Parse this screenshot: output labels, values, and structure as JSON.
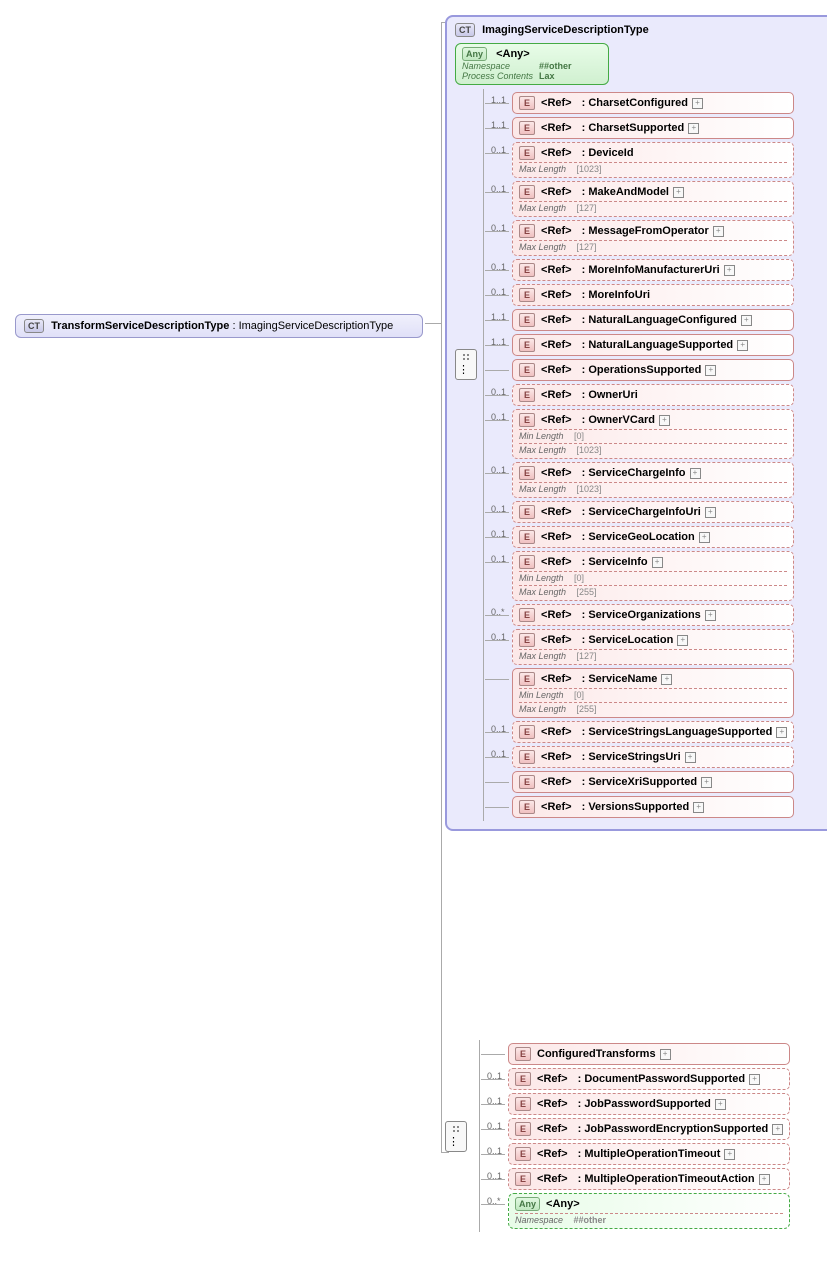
{
  "root": {
    "badge": "CT",
    "name": "TransformServiceDescriptionType",
    "base": "ImagingServiceDescriptionType"
  },
  "parentType": {
    "badge": "CT",
    "name": "ImagingServiceDescriptionType",
    "any": {
      "badge": "Any",
      "label": "<Any>",
      "namespace_k": "Namespace",
      "namespace_v": "##other",
      "pc_k": "Process Contents",
      "pc_v": "Lax"
    },
    "elements": [
      {
        "card": "1..1",
        "ref": "<Ref>",
        "name": ": CharsetConfigured",
        "dashed": false,
        "expand": true
      },
      {
        "card": "1..1",
        "ref": "<Ref>",
        "name": ": CharsetSupported",
        "dashed": false,
        "expand": true
      },
      {
        "card": "0..1",
        "ref": "<Ref>",
        "name": ": DeviceId",
        "dashed": true,
        "constraints": [
          {
            "k": "Max Length",
            "v": "[1023]"
          }
        ]
      },
      {
        "card": "0..1",
        "ref": "<Ref>",
        "name": ": MakeAndModel",
        "dashed": true,
        "expand": true,
        "constraints": [
          {
            "k": "Max Length",
            "v": "[127]"
          }
        ]
      },
      {
        "card": "0..1",
        "ref": "<Ref>",
        "name": ": MessageFromOperator",
        "dashed": true,
        "expand": true,
        "constraints": [
          {
            "k": "Max Length",
            "v": "[127]"
          }
        ]
      },
      {
        "card": "0..1",
        "ref": "<Ref>",
        "name": ": MoreInfoManufacturerUri",
        "dashed": true,
        "expand": true
      },
      {
        "card": "0..1",
        "ref": "<Ref>",
        "name": ": MoreInfoUri",
        "dashed": true
      },
      {
        "card": "1..1",
        "ref": "<Ref>",
        "name": ": NaturalLanguageConfigured",
        "dashed": false,
        "expand": true
      },
      {
        "card": "1..1",
        "ref": "<Ref>",
        "name": ": NaturalLanguageSupported",
        "dashed": false,
        "expand": true
      },
      {
        "card": "",
        "ref": "<Ref>",
        "name": ": OperationsSupported",
        "dashed": false,
        "expand": true,
        "noCard": true
      },
      {
        "card": "0..1",
        "ref": "<Ref>",
        "name": ": OwnerUri",
        "dashed": true
      },
      {
        "card": "0..1",
        "ref": "<Ref>",
        "name": ": OwnerVCard",
        "dashed": true,
        "expand": true,
        "constraints": [
          {
            "k": "Min Length",
            "v": "[0]"
          },
          {
            "k": "Max Length",
            "v": "[1023]"
          }
        ]
      },
      {
        "card": "0..1",
        "ref": "<Ref>",
        "name": ": ServiceChargeInfo",
        "dashed": true,
        "expand": true,
        "constraints": [
          {
            "k": "Max Length",
            "v": "[1023]"
          }
        ]
      },
      {
        "card": "0..1",
        "ref": "<Ref>",
        "name": ": ServiceChargeInfoUri",
        "dashed": true,
        "expand": true
      },
      {
        "card": "0..1",
        "ref": "<Ref>",
        "name": ": ServiceGeoLocation",
        "dashed": true,
        "expand": true
      },
      {
        "card": "0..1",
        "ref": "<Ref>",
        "name": ": ServiceInfo",
        "dashed": true,
        "expand": true,
        "constraints": [
          {
            "k": "Min Length",
            "v": "[0]"
          },
          {
            "k": "Max Length",
            "v": "[255]"
          }
        ]
      },
      {
        "card": "0..*",
        "ref": "<Ref>",
        "name": ": ServiceOrganizations",
        "dashed": true,
        "expand": true
      },
      {
        "card": "0..1",
        "ref": "<Ref>",
        "name": ": ServiceLocation",
        "dashed": true,
        "expand": true,
        "constraints": [
          {
            "k": "Max Length",
            "v": "[127]"
          }
        ]
      },
      {
        "card": "",
        "ref": "<Ref>",
        "name": ": ServiceName",
        "dashed": false,
        "expand": true,
        "noCard": true,
        "constraints": [
          {
            "k": "Min Length",
            "v": "[0]"
          },
          {
            "k": "Max Length",
            "v": "[255]"
          }
        ]
      },
      {
        "card": "0..1",
        "ref": "<Ref>",
        "name": ": ServiceStringsLanguageSupported",
        "dashed": true,
        "expand": true
      },
      {
        "card": "0..1",
        "ref": "<Ref>",
        "name": ": ServiceStringsUri",
        "dashed": true,
        "expand": true
      },
      {
        "card": "",
        "ref": "<Ref>",
        "name": ": ServiceXriSupported",
        "dashed": false,
        "expand": true,
        "noCard": true
      },
      {
        "card": "",
        "ref": "<Ref>",
        "name": ": VersionsSupported",
        "dashed": false,
        "expand": true,
        "noCard": true
      }
    ]
  },
  "extension": {
    "elements": [
      {
        "card": "",
        "badge": "E",
        "name": "ConfiguredTransforms",
        "dashed": false,
        "expand": true,
        "plain": true,
        "noCard": true
      },
      {
        "card": "0..1",
        "ref": "<Ref>",
        "name": ": DocumentPasswordSupported",
        "dashed": true,
        "expand": true
      },
      {
        "card": "0..1",
        "ref": "<Ref>",
        "name": ": JobPasswordSupported",
        "dashed": true,
        "expand": true
      },
      {
        "card": "0..1",
        "ref": "<Ref>",
        "name": ": JobPasswordEncryptionSupported",
        "dashed": true,
        "expand": true
      },
      {
        "card": "0..1",
        "ref": "<Ref>",
        "name": ": MultipleOperationTimeout",
        "dashed": true,
        "expand": true
      },
      {
        "card": "0..1",
        "ref": "<Ref>",
        "name": ": MultipleOperationTimeoutAction",
        "dashed": true,
        "expand": true
      }
    ],
    "any": {
      "card": "0..*",
      "badge": "Any",
      "label": "<Any>",
      "namespace_k": "Namespace",
      "namespace_v": "##other"
    }
  }
}
